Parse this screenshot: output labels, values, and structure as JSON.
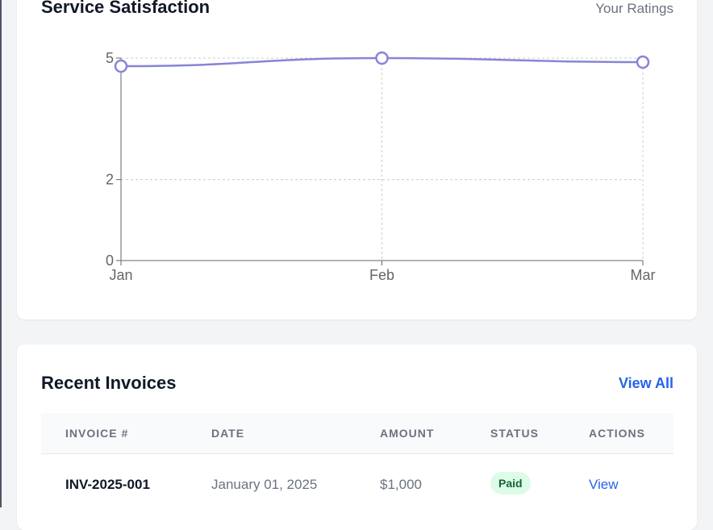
{
  "satisfaction": {
    "title": "Service Satisfaction",
    "subtitle": "Your Ratings"
  },
  "chart_data": {
    "type": "line",
    "categories": [
      "Jan",
      "Feb",
      "Mar"
    ],
    "series": [
      {
        "values": [
          4.8,
          5.0,
          4.9
        ],
        "color": "#8884d8"
      }
    ],
    "yticks": [
      0,
      2,
      5
    ],
    "ylim": [
      0,
      5
    ],
    "grid": true
  },
  "invoices": {
    "title": "Recent Invoices",
    "view_all": "View All",
    "columns": [
      "INVOICE #",
      "DATE",
      "AMOUNT",
      "STATUS",
      "ACTIONS"
    ],
    "rows": [
      {
        "invoice": "INV-2025-001",
        "date": "January 01, 2025",
        "amount": "$1,000",
        "status": "Paid",
        "action": "View"
      }
    ]
  }
}
